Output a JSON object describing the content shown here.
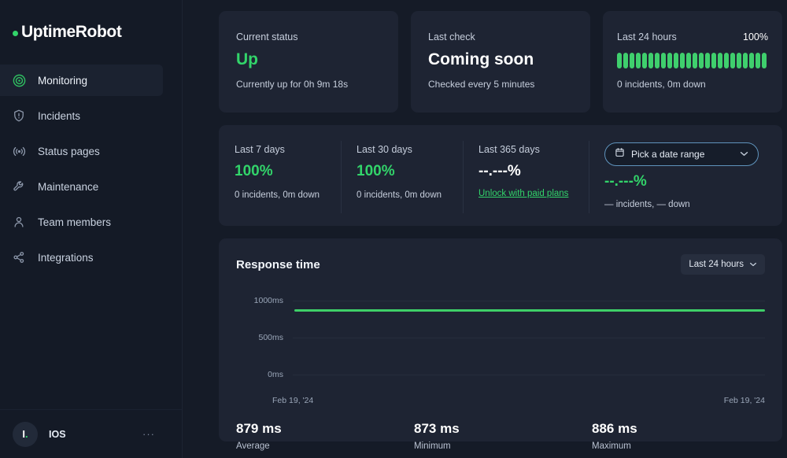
{
  "brand": {
    "name": "UptimeRobot",
    "dot_color": "#32d46a"
  },
  "sidebar": {
    "items": [
      {
        "label": "Monitoring",
        "icon": "target-icon",
        "active": true
      },
      {
        "label": "Incidents",
        "icon": "shield-alert-icon",
        "active": false
      },
      {
        "label": "Status pages",
        "icon": "broadcast-icon",
        "active": false
      },
      {
        "label": "Maintenance",
        "icon": "wrench-icon",
        "active": false
      },
      {
        "label": "Team members",
        "icon": "user-icon",
        "active": false
      },
      {
        "label": "Integrations",
        "icon": "share-nodes-icon",
        "active": false
      }
    ],
    "account": {
      "avatar_initial": "I",
      "avatar_dot": ".",
      "name": "IOS",
      "menu": "···"
    }
  },
  "cards": {
    "current_status": {
      "label": "Current status",
      "value": "Up",
      "sub": "Currently up for 0h 9m 18s"
    },
    "last_check": {
      "label": "Last check",
      "value": "Coming soon",
      "sub": "Checked every 5 minutes"
    },
    "last_24h": {
      "label": "Last 24 hours",
      "percent": "100%",
      "sub": "0 incidents, 0m down",
      "bar_count": 24,
      "bar_color": "#3fcf6d"
    }
  },
  "uptime": {
    "last_7_days": {
      "label": "Last 7 days",
      "value": "100%",
      "sub": "0 incidents, 0m down"
    },
    "last_30_days": {
      "label": "Last 30 days",
      "value": "100%",
      "sub": "0 incidents, 0m down"
    },
    "last_365_days": {
      "label": "Last 365 days",
      "value": "--.---%",
      "link": "Unlock with paid plans"
    },
    "custom_range": {
      "picker_label": "Pick a date range",
      "picker_icon": "calendar-icon",
      "chevron": "⌄",
      "value": "--.---%",
      "sub": "— incidents, — down"
    }
  },
  "response_time": {
    "title": "Response time",
    "range_label": "Last 24 hours",
    "stats": [
      {
        "value": "879 ms",
        "label": "Average"
      },
      {
        "value": "873 ms",
        "label": "Minimum"
      },
      {
        "value": "886 ms",
        "label": "Maximum"
      }
    ]
  },
  "chart_data": {
    "type": "line",
    "title": "Response time",
    "xlabel": "",
    "ylabel": "",
    "ylim": [
      0,
      1000
    ],
    "yticks": [
      1000,
      500,
      0
    ],
    "ytick_labels": [
      "1000ms",
      "500ms",
      "0ms"
    ],
    "xtick_labels": [
      "Feb 19, '24",
      "Feb 19, '24"
    ],
    "grid": true,
    "legend": false,
    "line_color": "#3ecf68",
    "series": [
      {
        "name": "Response time (ms)",
        "values": [
          879,
          880,
          878,
          873,
          881,
          879,
          884,
          877,
          880,
          886,
          879,
          875,
          878,
          882,
          879,
          880,
          873,
          886,
          879,
          878,
          881,
          879,
          877,
          880
        ]
      }
    ],
    "average": 879,
    "minimum": 873,
    "maximum": 886,
    "unit": "ms"
  }
}
